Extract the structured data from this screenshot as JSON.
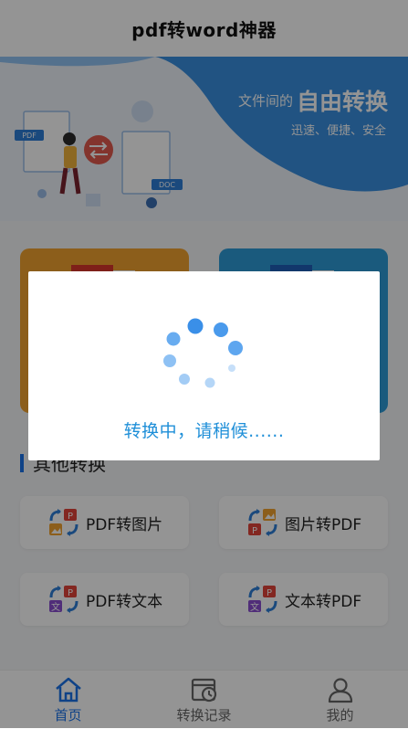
{
  "header": {
    "title": "pdf转word神器"
  },
  "banner": {
    "title_small": "文件间的",
    "title_big": "自由转换",
    "subtitle": "迅速、便捷、安全",
    "pdf_tag": "PDF",
    "doc_tag": "DOC"
  },
  "section": {
    "title": "其他转换"
  },
  "tools": [
    {
      "label": "PDF转图片",
      "icon": "pdf-to-image-icon"
    },
    {
      "label": "图片转PDF",
      "icon": "image-to-pdf-icon"
    },
    {
      "label": "PDF转文本",
      "icon": "pdf-to-text-icon"
    },
    {
      "label": "文本转PDF",
      "icon": "text-to-pdf-icon"
    }
  ],
  "icon_glyphs": {
    "pdf": "P",
    "text": "文"
  },
  "bottom_nav": [
    {
      "label": "首页",
      "icon": "home-icon",
      "active": true
    },
    {
      "label": "转换记录",
      "icon": "history-icon",
      "active": false
    },
    {
      "label": "我的",
      "icon": "user-icon",
      "active": false
    }
  ],
  "dialog": {
    "message": "转换中，请稍候......"
  },
  "colors": {
    "accent": "#1a73e8",
    "banner_blue": "#3a8fe0",
    "card_orange": "#f2a330",
    "card_blue": "#2d9bd7",
    "loading_text": "#1f8fd8"
  }
}
